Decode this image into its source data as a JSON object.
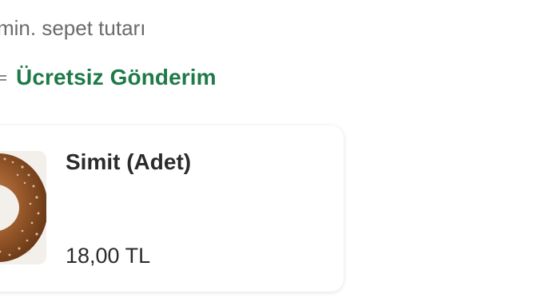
{
  "basket": {
    "min_label": "min. sepet tutarı"
  },
  "shipping": {
    "label": "Ücretsiz Gönderim",
    "icon": "truck-icon",
    "color": "#1f7a48"
  },
  "product": {
    "name": "Simit (Adet)",
    "price": "18,00 TL",
    "image_icon": "simit-image"
  }
}
